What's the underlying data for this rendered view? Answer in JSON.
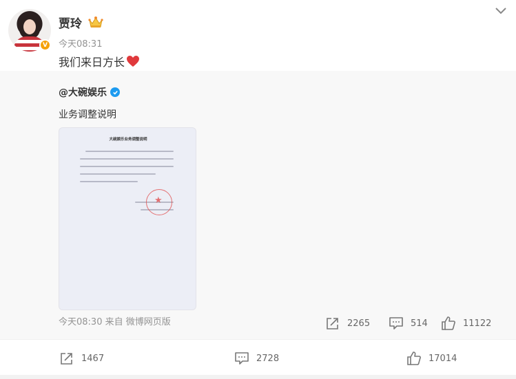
{
  "post": {
    "username": "贾玲",
    "timestamp": "今天08:31",
    "text": "我们来日方长",
    "badge_letter": "V",
    "icons": [
      "avatar",
      "verified-badge-icon",
      "crown-icon",
      "chevron-down-icon",
      "heart-emoji-icon"
    ]
  },
  "repost": {
    "username": "@大碗娱乐",
    "text": "业务调整说明",
    "image": {
      "doc_title": "大碗娱乐业务调整说明",
      "icons": [
        "document-image",
        "red-seal-stamp"
      ]
    },
    "meta": "今天08:30 来自 微博网页版",
    "actions": {
      "share_count": "2265",
      "comment_count": "514",
      "like_count": "11122"
    }
  },
  "actions": {
    "share_count": "1467",
    "comment_count": "2728",
    "like_count": "17014"
  },
  "colors": {
    "text": "#333333",
    "muted": "#939393",
    "repost_bg": "#f8f8f8",
    "verified_orange": "#f5a20a",
    "verified_blue": "#1d9bf0",
    "heart": "#e0393c"
  }
}
